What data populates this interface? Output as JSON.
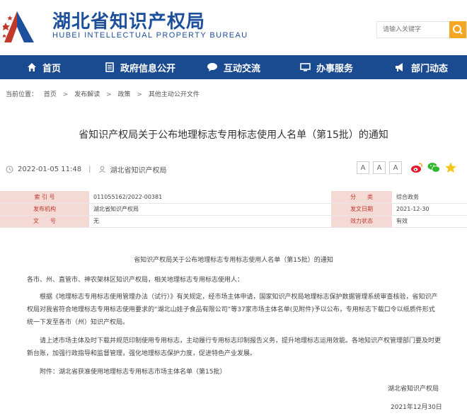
{
  "site": {
    "title": "湖北省知识产权局",
    "subtitle": "HUBEI INTELLECTUAL PROPERTY BUREAU",
    "brand_color": "#1a4a8f",
    "accent_color": "#f5a623"
  },
  "search": {
    "placeholder": "请输入关键字",
    "icon": "search-icon"
  },
  "nav": {
    "items": [
      {
        "label": "首页",
        "icon": "home-icon"
      },
      {
        "label": "政府信息公开",
        "icon": "document-icon"
      },
      {
        "label": "互动交流",
        "icon": "chat-icon"
      },
      {
        "label": "办事服务",
        "icon": "monitor-icon"
      },
      {
        "label": "部门动态",
        "icon": "megaphone-icon"
      }
    ]
  },
  "breadcrumb": {
    "prefix": "当前位置：",
    "items": [
      "首页",
      "发布解读",
      "政策",
      "其他主动公开文件"
    ],
    "separator": ">"
  },
  "article": {
    "title": "省知识产权局关于公布地理标志专用标志使用人名单（第15批）的通知",
    "date": "2022-01-05 11:48",
    "source": "湖北省知识产权局",
    "meta_sep": "|"
  },
  "toolbar": {
    "font_sizes": [
      "A",
      "A",
      "A"
    ],
    "share_icons": [
      "weibo-icon",
      "wechat-icon",
      "star-icon"
    ]
  },
  "info_table": {
    "rows": [
      {
        "k1": "索 引 号",
        "v1": "011055162/2022-00381",
        "k2": "分　　类",
        "v2": "综合政务"
      },
      {
        "k1": "发布机构",
        "v1": "湖北省知识产权局",
        "k2": "发文日期",
        "v2": "2021-12-30"
      },
      {
        "k1": "文　　号",
        "v1": "无",
        "k2": "效力状态",
        "v2": "有效"
      }
    ]
  },
  "document": {
    "heading": "省知识产权局关于公布地理标志专用标志使用人名单（第15批）的通知",
    "salutation": "各市、州、直管市、神农架林区知识产权局，相关地理标志专用标志使用人：",
    "para1_line1": "根据《地理标志专用标志使用管理办法（试行）》有关规定，经市场主体申请，国家知识产权局地理标志保护数据管理系统审查核验，省知识产",
    "para1_line2": "权局对我省符合地理标志专用标志使用要求的“湖北山娃子食品有限公司”等37家市场主体名单(见附件)予以公布，专用标志下载口令以纸质件形式",
    "para1_line3": "统一下发至各市（州）知识产权局。",
    "para2_line1": "请上述市场主体及时下载并规范印制使用专用标志，主动履行专用标志印制报告义务，提升地理标志运用效能。各地知识产权管理部门要及时更",
    "para2_line2": "新台账，加强行政指导和监督管理，强化地理标志保护力度，促进特色产业发展。",
    "attachment": "附件：湖北省获准使用地理标志专用标志市场主体名单（第15批）",
    "signature": "湖北省知识产权局",
    "sign_date": "2021年12月30日"
  }
}
